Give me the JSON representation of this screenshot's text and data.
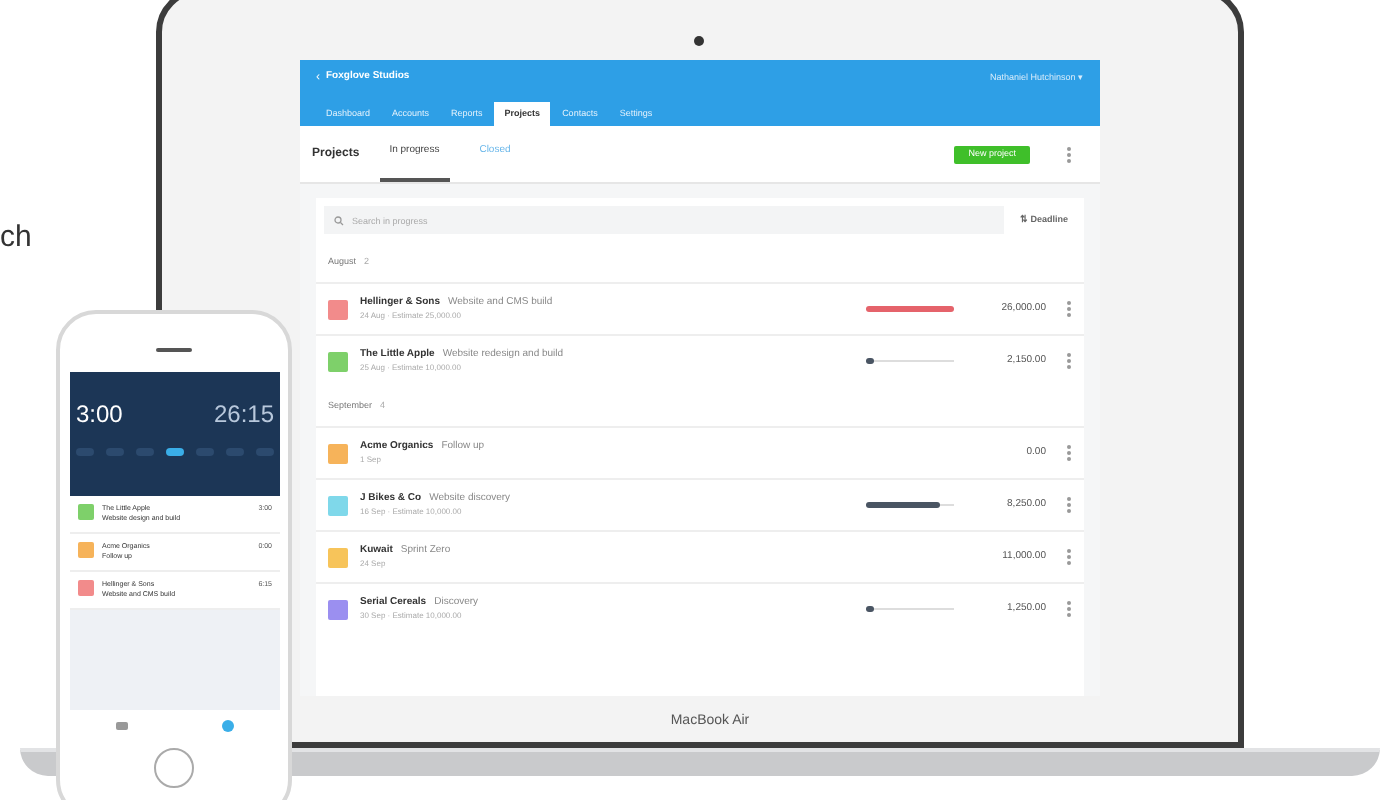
{
  "side_text": "ch",
  "laptop": {
    "brand": "MacBook Air",
    "header": {
      "back": "‹",
      "company": "Foxglove Studios",
      "user": "Nathaniel Hutchinson",
      "caret": "▾"
    },
    "nav": [
      {
        "label": "Dashboard",
        "selected": false
      },
      {
        "label": "Accounts",
        "selected": false
      },
      {
        "label": "Reports",
        "selected": false
      },
      {
        "label": "Projects",
        "selected": true
      },
      {
        "label": "Contacts",
        "selected": false
      },
      {
        "label": "Settings",
        "selected": false
      }
    ],
    "subheader": {
      "title": "Projects",
      "tabs": [
        {
          "label": "In progress",
          "selected": true
        },
        {
          "label": "Closed",
          "selected": false
        }
      ],
      "button": "New project"
    },
    "search": {
      "placeholder": "Search in progress",
      "sort_icon": "⇅",
      "sort": "Deadline"
    },
    "groups": [
      {
        "label": "August",
        "count": "2",
        "rows": [
          {
            "client": "Hellinger & Sons",
            "project": "Website and CMS build",
            "meta": "24 Aug · Estimate 25,000.00",
            "color": "#f28b8b",
            "bar": {
              "level": 1,
              "over": true
            },
            "amount": "26,000.00"
          },
          {
            "client": "The Little Apple",
            "project": "Website redesign and build",
            "meta": "25 Aug · Estimate 10,000.00",
            "color": "#7ed06a",
            "bar": {
              "level": 0.1,
              "over": false
            },
            "amount": "2,150.00"
          }
        ]
      },
      {
        "label": "September",
        "count": "4",
        "rows": [
          {
            "client": "Acme Organics",
            "project": "Follow up",
            "meta": "1 Sep",
            "color": "#f6b35a",
            "amount": "0.00"
          },
          {
            "client": "J Bikes & Co",
            "project": "Website discovery",
            "meta": "16 Sep · Estimate 10,000.00",
            "color": "#7fd8ea",
            "bar": {
              "level": 0.85,
              "over": false
            },
            "amount": "8,250.00"
          },
          {
            "client": "Kuwait",
            "project": "Sprint Zero",
            "meta": "24 Sep",
            "color": "#f7c45a",
            "amount": "11,000.00"
          },
          {
            "client": "Serial Cereals",
            "project": "Discovery",
            "meta": "30 Sep · Estimate 10,000.00",
            "color": "#9b8ff0",
            "bar": {
              "level": 0.1,
              "over": false
            },
            "amount": "1,250.00"
          }
        ]
      }
    ]
  },
  "phone": {
    "timer": "3:00",
    "total": "26:15",
    "days": [
      {
        "selected": false
      },
      {
        "selected": false
      },
      {
        "selected": false
      },
      {
        "selected": true
      },
      {
        "selected": false
      },
      {
        "selected": false
      },
      {
        "selected": false
      }
    ],
    "entries": [
      {
        "client": "The Little Apple",
        "project": "Website design and build",
        "time": "3:00",
        "color": "#7ed06a"
      },
      {
        "client": "Acme Organics",
        "project": "Follow up",
        "time": "0:00",
        "color": "#f6b35a"
      },
      {
        "client": "Hellinger & Sons",
        "project": "Website and CMS build",
        "time": "6:15",
        "color": "#f28b8b"
      }
    ],
    "tabs": [
      {
        "selected": false
      },
      {
        "selected": true
      }
    ]
  }
}
